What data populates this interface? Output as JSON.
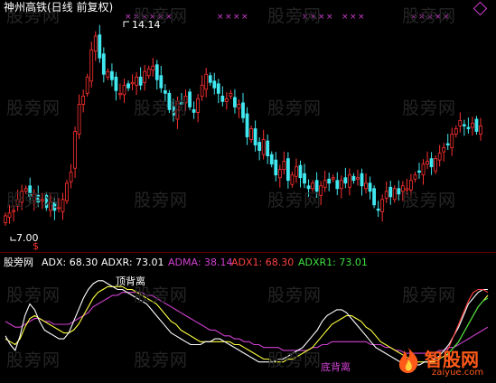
{
  "upper_panel": {
    "title": "神州高铁(日线 前复权)",
    "high_label": "14.14",
    "low_label": "7.00"
  },
  "lower_panel": {
    "indicator_name": "股旁网",
    "adx": "ADX: 68.30",
    "adxr": "ADXR: 73.01",
    "adma": "ADMA: 38.14",
    "adx1": "ADX1: 68.30",
    "adxr1": "ADXR1: 73.01",
    "top_divergence_label": "顶背离",
    "bottom_divergence_label": "底背离"
  },
  "watermark": "股旁网",
  "logo": {
    "text": "智股网",
    "url": "zaiyue.com"
  },
  "colors": {
    "up": "#ff3030",
    "down": "#40e8f0",
    "adx_line": "#ffffff",
    "adxr_line": "#ffff40",
    "adma_line": "#d040d0",
    "adx1_line": "#ff4040",
    "adxr1_line": "#40e040",
    "marker": "#d040d0"
  },
  "chart_data": {
    "type": "candlestick",
    "high_annotation": 14.14,
    "low_annotation": 7.0,
    "ylim": [
      6.5,
      14.6
    ],
    "closes": [
      7.4,
      7.5,
      7.6,
      8.0,
      8.3,
      8.4,
      8.1,
      8.2,
      7.9,
      8.0,
      7.7,
      7.9,
      7.6,
      7.7,
      8.0,
      8.6,
      9.0,
      10.5,
      11.5,
      11.8,
      12.5,
      13.5,
      14.0,
      13.2,
      12.6,
      12.7,
      12.4,
      12.0,
      11.9,
      12.2,
      12.1,
      12.3,
      12.5,
      12.2,
      12.7,
      12.8,
      12.9,
      12.4,
      12.1,
      11.9,
      11.3,
      11.1,
      11.6,
      11.5,
      11.8,
      11.4,
      11.2,
      11.7,
      12.2,
      12.6,
      12.3,
      12.1,
      11.9,
      11.6,
      11.7,
      11.9,
      11.4,
      11.5,
      11.0,
      10.3,
      10.6,
      10.0,
      9.8,
      10.2,
      9.6,
      9.3,
      8.9,
      9.1,
      9.4,
      8.7,
      8.9,
      9.2,
      8.8,
      8.6,
      8.4,
      8.6,
      8.3,
      8.5,
      8.7,
      8.6,
      8.8,
      8.4,
      8.7,
      8.6,
      8.9,
      8.7,
      8.8,
      8.5,
      8.6,
      8.3,
      7.8,
      7.6,
      8.0,
      8.3,
      8.1,
      8.4,
      8.2,
      8.5,
      8.4,
      8.7,
      8.9,
      9.0,
      9.3,
      9.4,
      9.2,
      9.5,
      9.7,
      9.9,
      10.0,
      10.4,
      10.6,
      10.9,
      10.7,
      10.6,
      10.8,
      10.5,
      10.7
    ],
    "adx": [
      45,
      42,
      40,
      45,
      52,
      56,
      54,
      50,
      47,
      46,
      45,
      44,
      44,
      46,
      50,
      54,
      58,
      61,
      63,
      64,
      64,
      63,
      62,
      61,
      61,
      60,
      59,
      58,
      57,
      56,
      54,
      52,
      50,
      48,
      46,
      45,
      44,
      43,
      42,
      42,
      42,
      43,
      43,
      44,
      44,
      43,
      42,
      41,
      40,
      39,
      38,
      37,
      36,
      36,
      36,
      36,
      37,
      37,
      38,
      39,
      40,
      41,
      43,
      45,
      47,
      50,
      52,
      53,
      54,
      54,
      53,
      51,
      49,
      47,
      45,
      43,
      41,
      40,
      39,
      38,
      37,
      36,
      35,
      35,
      35,
      35,
      36,
      36,
      37,
      38,
      40,
      42,
      45,
      48,
      52,
      56,
      58,
      60,
      61,
      61
    ],
    "adxr": [
      44,
      43,
      42,
      44,
      48,
      51,
      52,
      51,
      50,
      49,
      48,
      47,
      46,
      46,
      47,
      49,
      52,
      55,
      58,
      60,
      61,
      62,
      62,
      62,
      62,
      61,
      61,
      60,
      59,
      58,
      57,
      56,
      54,
      52,
      50,
      49,
      47,
      46,
      45,
      44,
      43,
      43,
      43,
      43,
      43,
      43,
      43,
      42,
      42,
      41,
      40,
      39,
      38,
      37,
      37,
      36,
      36,
      36,
      37,
      37,
      38,
      39,
      40,
      41,
      43,
      45,
      47,
      49,
      50,
      51,
      52,
      52,
      51,
      50,
      48,
      47,
      45,
      43,
      42,
      41,
      40,
      39,
      38,
      37,
      36,
      36,
      36,
      36,
      36,
      37,
      38,
      39,
      41,
      43,
      46,
      49,
      52,
      55,
      57,
      59
    ],
    "adma": [
      50,
      49,
      48,
      48,
      49,
      50,
      51,
      51,
      50,
      50,
      49,
      49,
      49,
      49,
      50,
      51,
      52,
      53,
      55,
      56,
      57,
      58,
      59,
      59,
      60,
      60,
      60,
      60,
      60,
      59,
      59,
      58,
      57,
      56,
      55,
      54,
      53,
      52,
      51,
      50,
      49,
      48,
      47,
      47,
      46,
      45,
      45,
      44,
      44,
      43,
      43,
      42,
      42,
      41,
      41,
      41,
      41,
      40,
      40,
      40,
      40,
      40,
      40,
      41,
      41,
      42,
      42,
      43,
      43,
      43,
      43,
      43,
      43,
      43,
      43,
      42,
      42,
      42,
      41,
      41,
      40,
      40,
      39,
      39,
      39,
      39,
      39,
      39,
      39,
      40,
      40,
      41,
      41,
      42,
      43,
      44,
      45,
      46,
      47,
      48
    ],
    "adx1_tail": [
      38,
      41,
      45,
      49,
      53,
      57,
      60,
      61,
      61,
      60
    ],
    "adxr1_tail": [
      37,
      39,
      41,
      43,
      46,
      49,
      52,
      55,
      57,
      58
    ]
  }
}
